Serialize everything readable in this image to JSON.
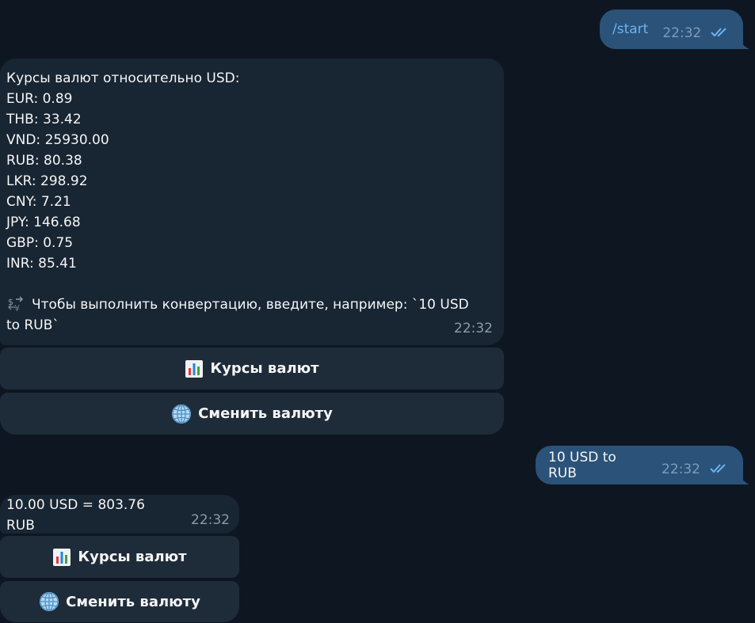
{
  "messages": {
    "start": {
      "text": "/start",
      "time": "22:32"
    },
    "rates": {
      "title": "Курсы валют относительно USD:",
      "lines": [
        "EUR: 0.89",
        "THB: 33.42",
        "VND: 25930.00",
        "RUB: 80.38",
        "LKR: 298.92",
        "CNY: 7.21",
        "JPY: 146.68",
        "GBP: 0.75",
        "INR: 85.41"
      ],
      "hint_line1": "Чтобы выполнить конвертацию, введите, например: `10 USD",
      "hint_line2": "to RUB`",
      "time": "22:32"
    },
    "convert_request": {
      "text": "10 USD to RUB",
      "time": "22:32"
    },
    "convert_result": {
      "text": "10.00 USD = 803.76 RUB",
      "time": "22:32"
    }
  },
  "keyboard": {
    "rates_label": "Курсы валют",
    "change_label": "Сменить валюту"
  },
  "icons": {
    "read_ticks": "double-check-icon",
    "hint": "currency-exchange-icon",
    "rates": "bar-chart-icon",
    "change": "globe-icon"
  },
  "colors": {
    "background": "#0e1621",
    "outgoing_bubble": "#2b5278",
    "incoming_bubble": "#182533",
    "keyboard_button": "#1e2c3a",
    "command_link": "#6ab3f3",
    "ticks": "#6ab3f3"
  }
}
